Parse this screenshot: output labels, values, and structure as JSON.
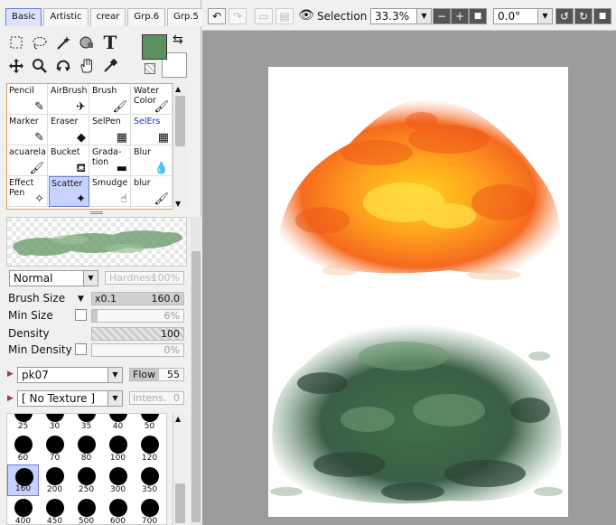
{
  "toolbar_left": {
    "tabs": [
      {
        "label": "Basic",
        "active": true
      },
      {
        "label": "Artistic",
        "active": false
      },
      {
        "label": "crear",
        "active": false
      },
      {
        "label": "Grp.6",
        "active": false
      },
      {
        "label": "Grp.5",
        "active": false
      }
    ],
    "tools": [
      "select-rect",
      "lasso",
      "magic-wand",
      "selection-pen",
      "text",
      "move",
      "zoom",
      "rotate",
      "hand",
      "eyedropper"
    ],
    "text_tool_glyph": "T",
    "primary_color": "#5e8f5e",
    "secondary_color": "#ffffff"
  },
  "brushes": [
    {
      "label": "Pencil",
      "icon": "pencil-icon"
    },
    {
      "label": "AirBrush",
      "icon": "airbrush-icon"
    },
    {
      "label": "Brush",
      "icon": "brush-icon"
    },
    {
      "label": "Water Color",
      "icon": "watercolor-icon"
    },
    {
      "label": "Marker",
      "icon": "marker-icon"
    },
    {
      "label": "Eraser",
      "icon": "eraser-icon"
    },
    {
      "label": "SelPen",
      "icon": "selpen-icon"
    },
    {
      "label": "SelErs",
      "icon": "selers-icon"
    },
    {
      "label": "acuarela",
      "icon": "acuarela-icon"
    },
    {
      "label": "Bucket",
      "icon": "bucket-icon"
    },
    {
      "label": "Grada-tion",
      "icon": "gradation-icon"
    },
    {
      "label": "Blur",
      "icon": "blur-icon"
    },
    {
      "label": "Effect Pen",
      "icon": "effect-pen-icon"
    },
    {
      "label": "Scatter",
      "icon": "scatter-icon"
    },
    {
      "label": "Smudge",
      "icon": "smudge-icon"
    },
    {
      "label": "blur",
      "icon": "blur2-icon"
    }
  ],
  "selected_brush": "Scatter",
  "settings": {
    "blend_mode": "Normal",
    "hardness_label": "Hardness",
    "hardness_value": "100%",
    "brush_size_label": "Brush Size",
    "brush_size_mult": "x0.1",
    "brush_size_value": "160.0",
    "min_size_label": "Min Size",
    "min_size_value": "6%",
    "density_label": "Density",
    "density_value": "100",
    "min_density_label": "Min Density",
    "min_density_value": "0%",
    "texture_brush": "pk07",
    "flow_label": "Flow",
    "flow_value": "55",
    "texture": "[ No Texture ]",
    "intens_label": "Intens.",
    "intens_value": "0"
  },
  "sizes": [
    "25",
    "30",
    "35",
    "40",
    "50",
    "60",
    "70",
    "80",
    "100",
    "120",
    "160",
    "200",
    "250",
    "300",
    "350",
    "400",
    "450",
    "500",
    "600",
    "700"
  ],
  "selected_size": "160",
  "top_toolbar": {
    "selection_label": "Selection",
    "zoom": "33.3%",
    "rotation": "0.0°"
  }
}
